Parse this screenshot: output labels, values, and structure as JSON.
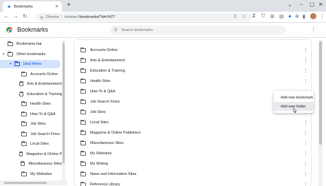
{
  "browser": {
    "tab_title": "Bookmarks",
    "new_tab": "+",
    "site_label": "Chrome",
    "url_sep": "|",
    "url_host": "chrome://",
    "url_path": "bookmarks/?id=2477"
  },
  "header": {
    "title": "Bookmarks",
    "search_placeholder": "Search bookmarks"
  },
  "sidebar": {
    "items": [
      {
        "label": "Bookmarks bar",
        "indent": 0,
        "arrow": ""
      },
      {
        "label": "Other bookmarks",
        "indent": 0,
        "arrow": "▾"
      },
      {
        "label": "[sits] Menu",
        "indent": 1,
        "arrow": "▾",
        "selected": true
      },
      {
        "label": "Accounts Online",
        "indent": 2,
        "arrow": ""
      },
      {
        "label": "Arts & Entertainment",
        "indent": 2,
        "arrow": ""
      },
      {
        "label": "Education & Training",
        "indent": 2,
        "arrow": ""
      },
      {
        "label": "Health Sites",
        "indent": 2,
        "arrow": ""
      },
      {
        "label": "How To & Q&A",
        "indent": 2,
        "arrow": ""
      },
      {
        "label": "Job Sites",
        "indent": 2,
        "arrow": ""
      },
      {
        "label": "Job Search Firms",
        "indent": 2,
        "arrow": ""
      },
      {
        "label": "Local Sites",
        "indent": 2,
        "arrow": ""
      },
      {
        "label": "Magazine & Online P",
        "indent": 2,
        "arrow": ""
      },
      {
        "label": "Miscellaneous Sites",
        "indent": 2,
        "arrow": ""
      },
      {
        "label": "My Websites",
        "indent": 2,
        "arrow": ""
      }
    ]
  },
  "list": {
    "items": [
      "Accounts Online",
      "Arts & Entertainment",
      "Education & Training",
      "Health Sites",
      "How To & Q&A",
      "Job Search Firms",
      "Job Sites",
      "Local Sites",
      "Magazine & Online Publishers",
      "Miscellaneous Sites",
      "My Websites",
      "My Writing",
      "News and Information Sites",
      "Reference Library"
    ]
  },
  "context_menu": {
    "items": [
      "Add new bookmark",
      "Add new folder"
    ],
    "hovered": "Add new folder"
  }
}
